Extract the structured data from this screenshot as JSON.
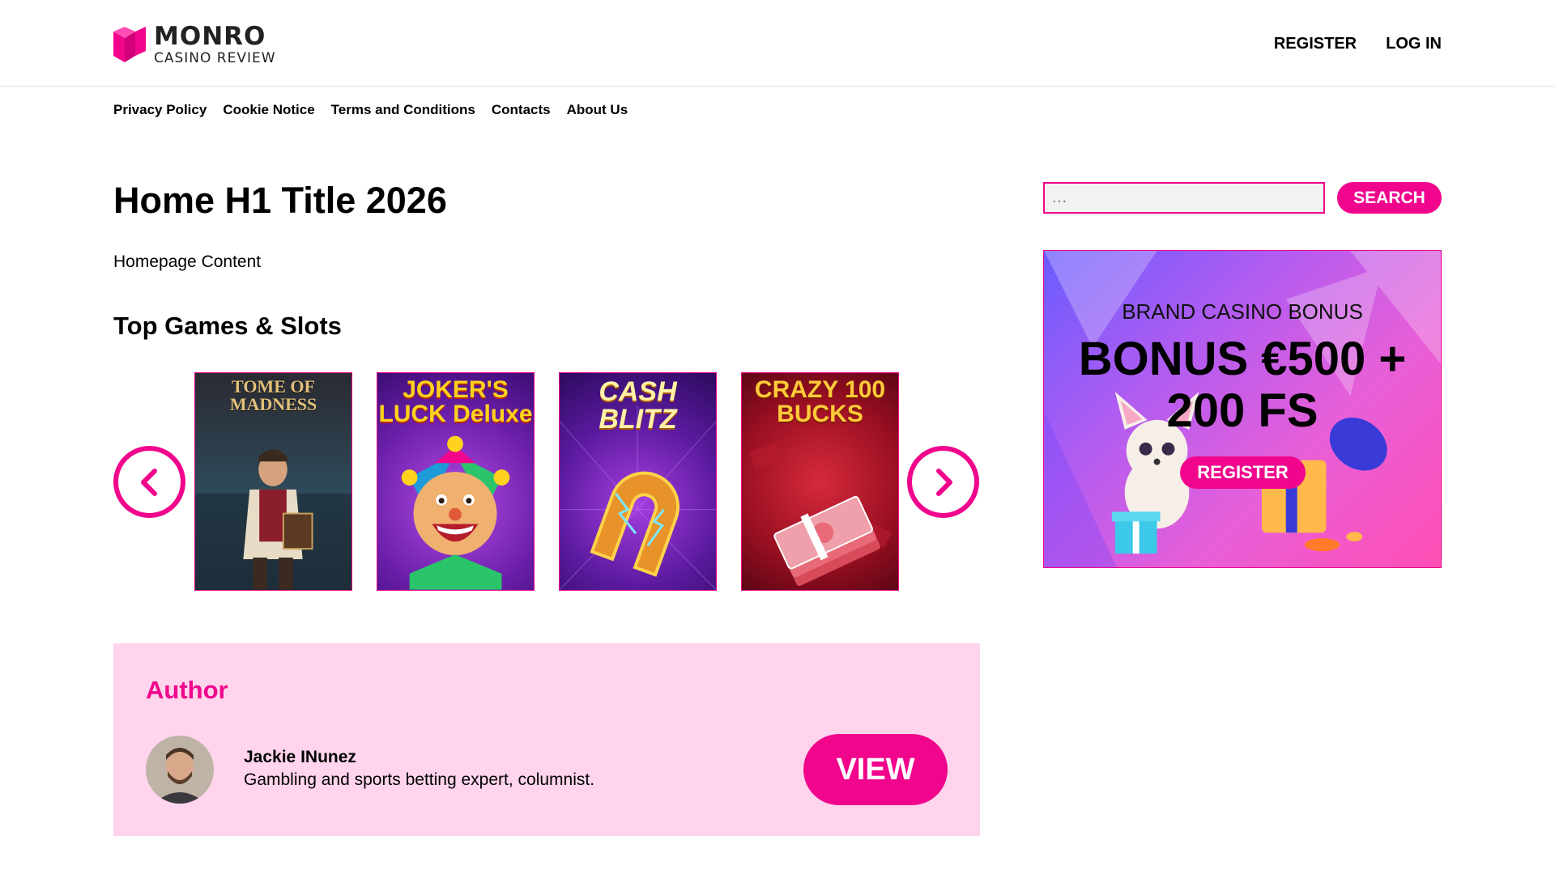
{
  "header": {
    "logo": {
      "name": "MONRO",
      "subtitle": "CASINO REVIEW"
    },
    "register_label": "REGISTER",
    "login_label": "LOG IN"
  },
  "nav": {
    "items": [
      {
        "label": "Privacy Policy"
      },
      {
        "label": "Cookie Notice"
      },
      {
        "label": "Terms and Conditions"
      },
      {
        "label": "Contacts"
      },
      {
        "label": "About Us"
      }
    ]
  },
  "main": {
    "title": "Home H1 Title 2026",
    "content": "Homepage Content",
    "games_heading": "Top Games & Slots",
    "games": [
      {
        "title": "TOME OF MADNESS"
      },
      {
        "title": "JOKER'S LUCK Deluxe"
      },
      {
        "title": "CASH BLITZ"
      },
      {
        "title": "CRAZY 100 BUCKS"
      }
    ]
  },
  "author": {
    "heading": "Author",
    "name": "Jackie INunez",
    "bio": "Gambling and sports betting expert, columnist.",
    "view_label": "VIEW"
  },
  "sidebar": {
    "search": {
      "placeholder": "…",
      "button_label": "SEARCH"
    },
    "banner": {
      "label": "BRAND CASINO BONUS",
      "offer": "BONUS €500 + 200 FS",
      "button_label": "REGISTER"
    }
  },
  "colors": {
    "accent": "#f0058c",
    "author_bg": "#ffd4ec"
  }
}
